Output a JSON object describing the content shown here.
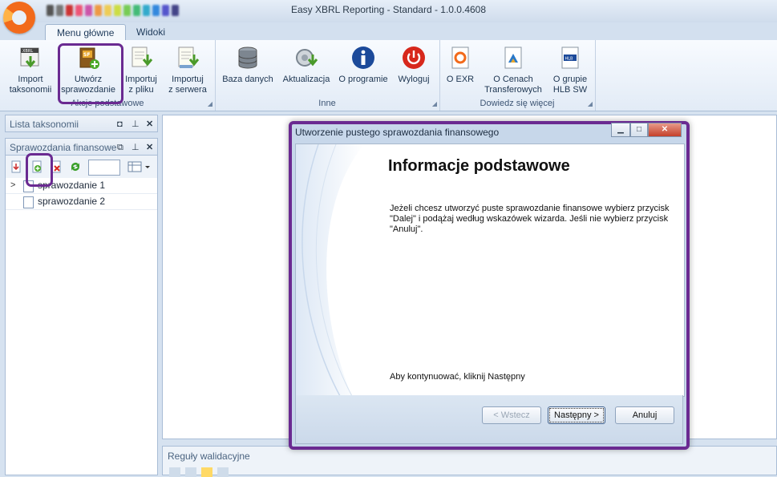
{
  "app": {
    "title": "Easy XBRL Reporting - Standard - 1.0.0.4608"
  },
  "tabs": [
    {
      "label": "Menu główne"
    },
    {
      "label": "Widoki"
    }
  ],
  "ribbon": {
    "groups": [
      {
        "label": "Akcje podstawowe",
        "buttons": [
          {
            "label": "Import\ntaksonomii",
            "icon": "xbrl-import-icon"
          },
          {
            "label": "Utwórz\nsprawozdanie",
            "icon": "create-report-icon"
          },
          {
            "label": "Importuj\nz pliku",
            "icon": "import-file-icon"
          },
          {
            "label": "Importuj\nz serwera",
            "icon": "import-server-icon"
          }
        ]
      },
      {
        "label": "Inne",
        "buttons": [
          {
            "label": "Baza danych",
            "icon": "database-icon"
          },
          {
            "label": "Aktualizacja",
            "icon": "update-icon"
          },
          {
            "label": "O programie",
            "icon": "info-icon"
          },
          {
            "label": "Wyloguj",
            "icon": "power-icon"
          }
        ]
      },
      {
        "label": "Dowiedz się więcej",
        "buttons": [
          {
            "label": "O EXR",
            "icon": "exr-doc-icon"
          },
          {
            "label": "O Cenach\nTransferowych",
            "icon": "transfer-pricing-doc-icon"
          },
          {
            "label": "O grupie\nHLB SW",
            "icon": "hlb-doc-icon"
          }
        ]
      }
    ]
  },
  "panels": {
    "taxonomies": {
      "title": "Lista taksonomii"
    },
    "reports": {
      "title": "Sprawozdania finansowe",
      "items": [
        {
          "label": "sprawozdanie 1"
        },
        {
          "label": "sprawozdanie 2"
        }
      ]
    },
    "validation": {
      "title": "Reguły walidacyjne"
    }
  },
  "dialog": {
    "title": "Utworzenie pustego sprawozdania finansowego",
    "heading": "Informacje podstawowe",
    "body": "Jeżeli chcesz utworzyć puste sprawozdanie finansowe wybierz przycisk \"Dalej\" i podążaj według wskazówek wizarda. Jeśli nie wybierz przycisk \"Anuluj\".",
    "continue_text": "Aby kontynuować, kliknij Następny",
    "buttons": {
      "back": "< Wstecz",
      "next": "Następny >",
      "cancel": "Anuluj"
    }
  },
  "colors": {
    "highlight": "#6a2a91",
    "accent": "#f26a1b"
  }
}
